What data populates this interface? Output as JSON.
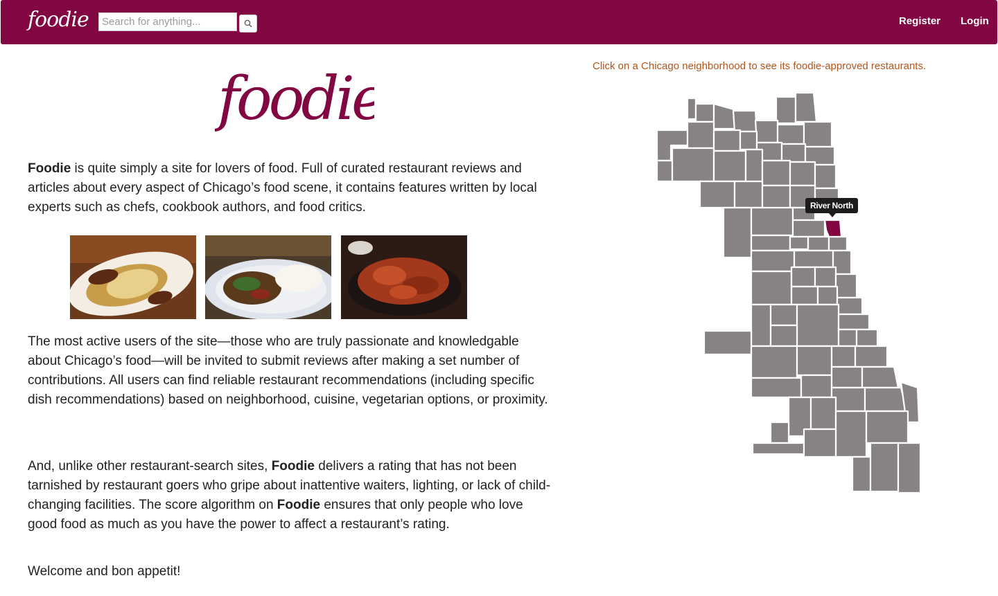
{
  "navbar": {
    "brand": "foodie",
    "search_placeholder": "Search for anything...",
    "register_label": "Register",
    "login_label": "Login"
  },
  "hero": {
    "logo_text": "foodie"
  },
  "intro": {
    "p1_bold": "Foodie",
    "p1_rest": " is quite simply a site for lovers of food. Full of curated restaurant reviews and articles about every aspect of Chicago’s food scene, it contains features written by local experts such as chefs, cookbook authors, and food critics.",
    "p2": "The most active users of the site—those who are truly passionate and knowledgable about Chicago’s food—will be invited to submit reviews after making a set number of contributions. All users can find reliable restaurant recommendations (including specific dish recommendations) based on neighborhood, cuisine, vegetarian options, or proximity.",
    "p3_a": "And, unlike other restaurant-search sites, ",
    "p3_bold1": "Foodie",
    "p3_b": " delivers a rating that has not been tarnished by restaurant goers who gripe about inattentive waiters, lighting, or lack of child-changing facilities. The score algorithm on ",
    "p3_bold2": "Foodie",
    "p3_c": " ensures that only people who love good food as much as you have the power to affect a restaurant’s rating.",
    "p4": "Welcome and bon appetit!"
  },
  "photos": [
    {
      "icon": "food-photo-kebab-rice"
    },
    {
      "icon": "food-photo-stirfry-rice"
    },
    {
      "icon": "food-photo-chicken-wings"
    }
  ],
  "map": {
    "hint": "Click on a Chicago neighborhood to see its foodie-approved restaurants.",
    "tooltip": "River North",
    "colors": {
      "neighborhood": "#878383",
      "highlight": "#820641",
      "border": "#ffffff"
    }
  },
  "colors": {
    "brand": "#820641",
    "hint": "#b5541a"
  }
}
